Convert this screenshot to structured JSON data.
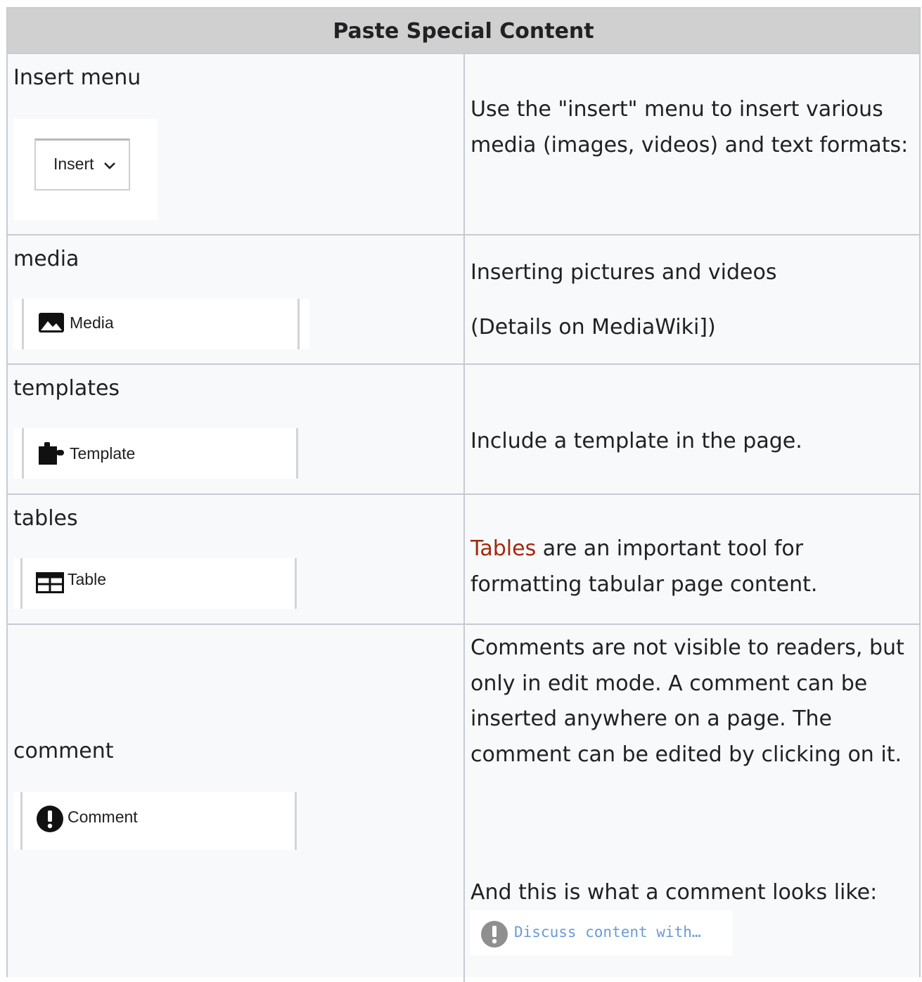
{
  "table": {
    "title": "Paste Special Content",
    "rows": [
      {
        "label": "Insert menu",
        "button_label": "Insert",
        "button_icon": "chevron-down-icon",
        "description": "Use the \"insert\" menu to insert various media (images, videos) and text formats:"
      },
      {
        "label": "media",
        "button_label": "Media",
        "button_icon": "image-icon",
        "description": "Inserting pictures and videos",
        "description_note": "(Details on MediaWiki])"
      },
      {
        "label": "templates",
        "button_label": "Template",
        "button_icon": "puzzle-icon",
        "description": "Include a template in the page."
      },
      {
        "label": "tables",
        "button_label": "Table",
        "button_icon": "table-icon",
        "description_link": "Tables",
        "description_rest": " are an important tool for formatting tabular page content."
      },
      {
        "label": "comment",
        "button_label": "Comment",
        "button_icon": "exclamation-circle-icon",
        "description": "Comments are not visible to readers, but only in edit mode. A comment can be inserted anywhere on a page. The comment can be edited by clicking on it.",
        "example_intro": "And this is what a comment looks like:",
        "example_text": "Discuss content with…",
        "example_icon": "exclamation-circle-icon"
      }
    ]
  },
  "colors": {
    "header_bg": "#d0d0d0",
    "cell_bg": "#f8f9fa",
    "border": "#c8ccd1",
    "link": "#a2290e",
    "comment_text": "#6b9bd6"
  }
}
